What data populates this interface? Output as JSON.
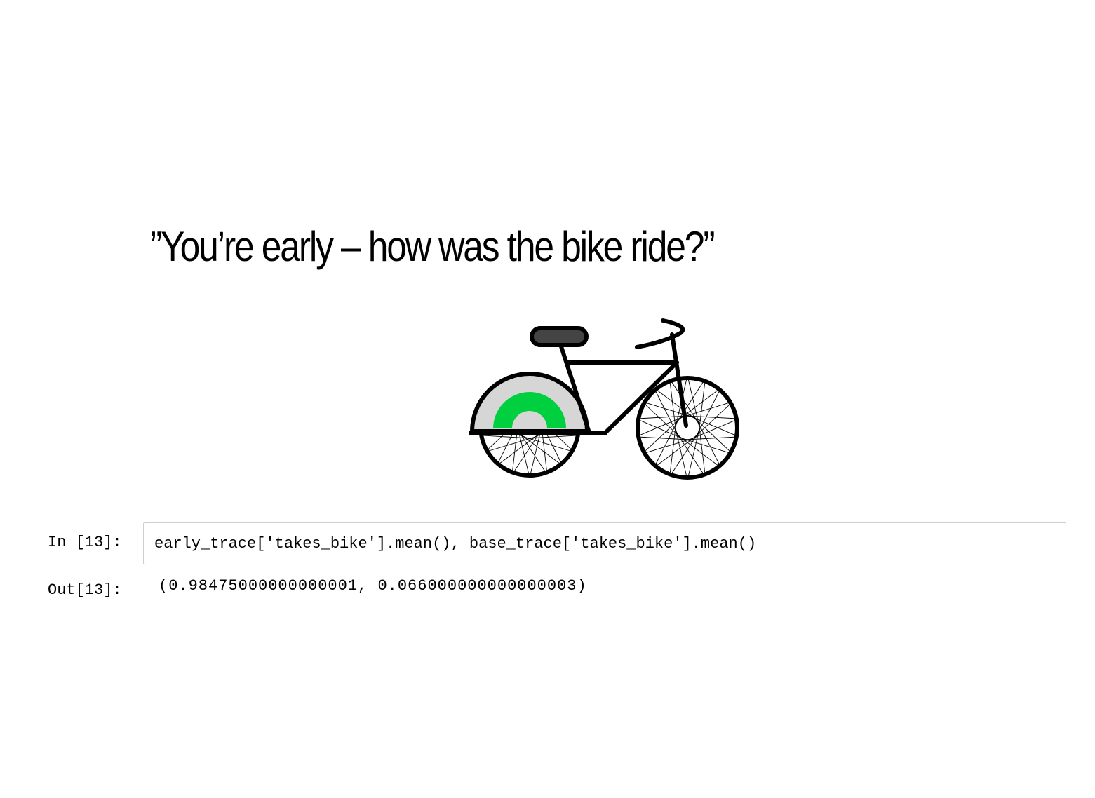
{
  "slide": {
    "heading": "”You’re early – how was the bike ride?”",
    "illustration": {
      "icon": "bicycle-icon",
      "colors": {
        "frame": "#000000",
        "seat": "#444444",
        "fender": "#d6d6d6",
        "fender_arc": "#00d040"
      }
    }
  },
  "cell": {
    "in_prompt": "In [13]:",
    "code": "early_trace['takes_bike'].mean(), base_trace['takes_bike'].mean()",
    "out_prompt": "Out[13]:",
    "output": "(0.98475000000000001, 0.066000000000000003)"
  }
}
